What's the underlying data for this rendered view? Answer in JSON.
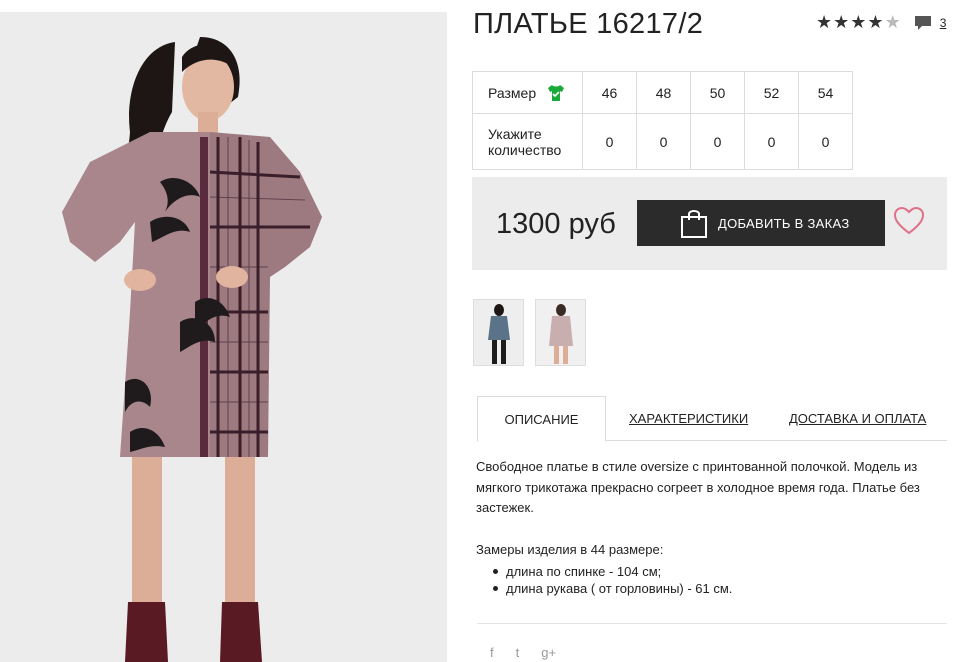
{
  "product": {
    "title": "ПЛАТЬЕ 16217/2",
    "rating": 4.5,
    "comments_count": "3"
  },
  "sizes": {
    "size_label": "Размер",
    "qty_label": "Укажите количество",
    "values": [
      "46",
      "48",
      "50",
      "52",
      "54"
    ],
    "quantities": [
      "0",
      "0",
      "0",
      "0",
      "0"
    ]
  },
  "order": {
    "price": "1300 руб",
    "add_label": "ДОБАВИТЬ В ЗАКАЗ"
  },
  "tabs": [
    {
      "label": "ОПИСАНИЕ",
      "active": true
    },
    {
      "label": "ХАРАКТЕРИСТИКИ",
      "active": false
    },
    {
      "label": "ДОСТАВКА И ОПЛАТА",
      "active": false
    }
  ],
  "description": {
    "text": "Свободное платье в стиле oversize с принтованной полочкой. Модель из мягкого трикотажа прекрасно согреет в холодное время года. Платье без застежек.",
    "measure_title": "Замеры изделия в 44 размере:",
    "measures": [
      "длина по спинке - 104 см;",
      "длина рукава ( от горловины) - 61 см."
    ]
  },
  "share": {
    "facebook": "f",
    "twitter": "t",
    "googleplus": "g+"
  },
  "colors": {
    "dress": "#a8868c",
    "dark": "#2b2b2b",
    "accent_heart": "#e0718a",
    "accent_shirt": "#1aaa3a"
  }
}
